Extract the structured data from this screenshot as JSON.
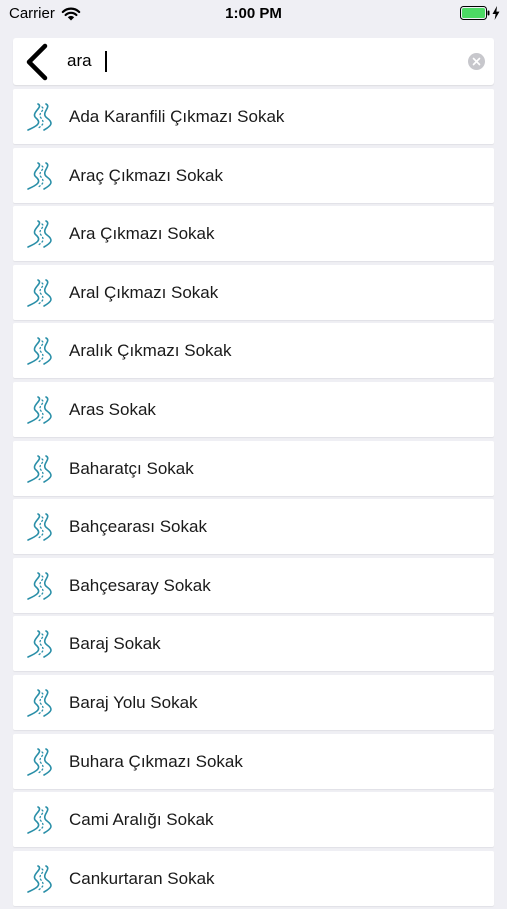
{
  "status_bar": {
    "carrier": "Carrier",
    "time": "1:00 PM",
    "battery_color": "#4cd964"
  },
  "search": {
    "value": "ara",
    "back_icon": "chevron-left-icon",
    "clear_icon": "clear-circle-icon"
  },
  "colors": {
    "icon_teal": "#2a8fa8",
    "background": "#efeff4"
  },
  "results": [
    {
      "label": "Ada Karanfili Çıkmazı Sokak",
      "icon": "road-icon"
    },
    {
      "label": "Araç Çıkmazı Sokak",
      "icon": "road-icon"
    },
    {
      "label": "Ara Çıkmazı Sokak",
      "icon": "road-icon"
    },
    {
      "label": "Aral Çıkmazı Sokak",
      "icon": "road-icon"
    },
    {
      "label": "Aralık Çıkmazı Sokak",
      "icon": "road-icon"
    },
    {
      "label": "Aras Sokak",
      "icon": "road-icon"
    },
    {
      "label": "Baharatçı Sokak",
      "icon": "road-icon"
    },
    {
      "label": "Bahçearası Sokak",
      "icon": "road-icon"
    },
    {
      "label": "Bahçesaray Sokak",
      "icon": "road-icon"
    },
    {
      "label": "Baraj Sokak",
      "icon": "road-icon"
    },
    {
      "label": "Baraj Yolu Sokak",
      "icon": "road-icon"
    },
    {
      "label": "Buhara Çıkmazı Sokak",
      "icon": "road-icon"
    },
    {
      "label": "Cami Aralığı Sokak",
      "icon": "road-icon"
    },
    {
      "label": "Cankurtaran Sokak",
      "icon": "road-icon"
    }
  ]
}
